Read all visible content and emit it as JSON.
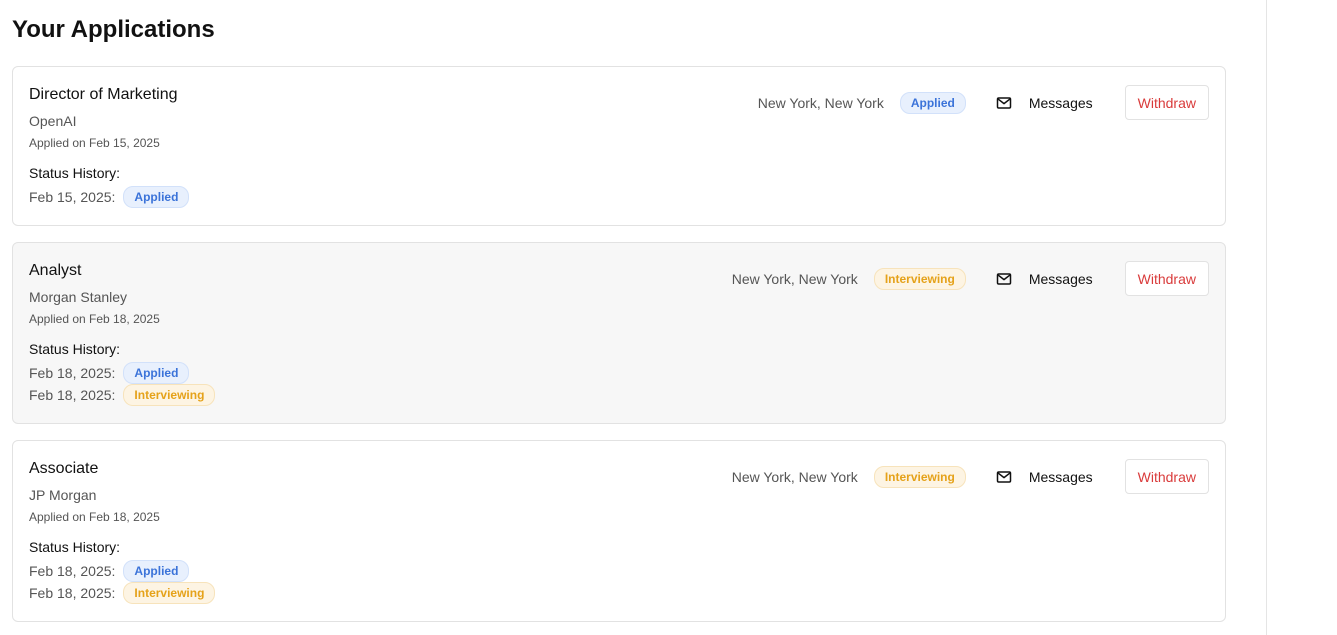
{
  "page_title": "Your Applications",
  "history_label": "Status History:",
  "messages_label": "Messages",
  "withdraw_label": "Withdraw",
  "status_colors": {
    "applied": "#3b73d9",
    "interviewing": "#e5a21a",
    "withdraw": "#d93b3b"
  },
  "icons": {
    "messages": "mail-icon"
  },
  "applications": [
    {
      "title": "Director of Marketing",
      "company": "OpenAI",
      "applied_on": "Applied on Feb 15, 2025",
      "location": "New York, New York",
      "status": "Applied",
      "history": [
        {
          "date": "Feb 15, 2025:",
          "status": "Applied"
        }
      ]
    },
    {
      "title": "Analyst",
      "company": "Morgan Stanley",
      "applied_on": "Applied on Feb 18, 2025",
      "location": "New York, New York",
      "status": "Interviewing",
      "history": [
        {
          "date": "Feb 18, 2025:",
          "status": "Applied"
        },
        {
          "date": "Feb 18, 2025:",
          "status": "Interviewing"
        }
      ]
    },
    {
      "title": "Associate",
      "company": "JP Morgan",
      "applied_on": "Applied on Feb 18, 2025",
      "location": "New York, New York",
      "status": "Interviewing",
      "history": [
        {
          "date": "Feb 18, 2025:",
          "status": "Applied"
        },
        {
          "date": "Feb 18, 2025:",
          "status": "Interviewing"
        }
      ]
    }
  ]
}
